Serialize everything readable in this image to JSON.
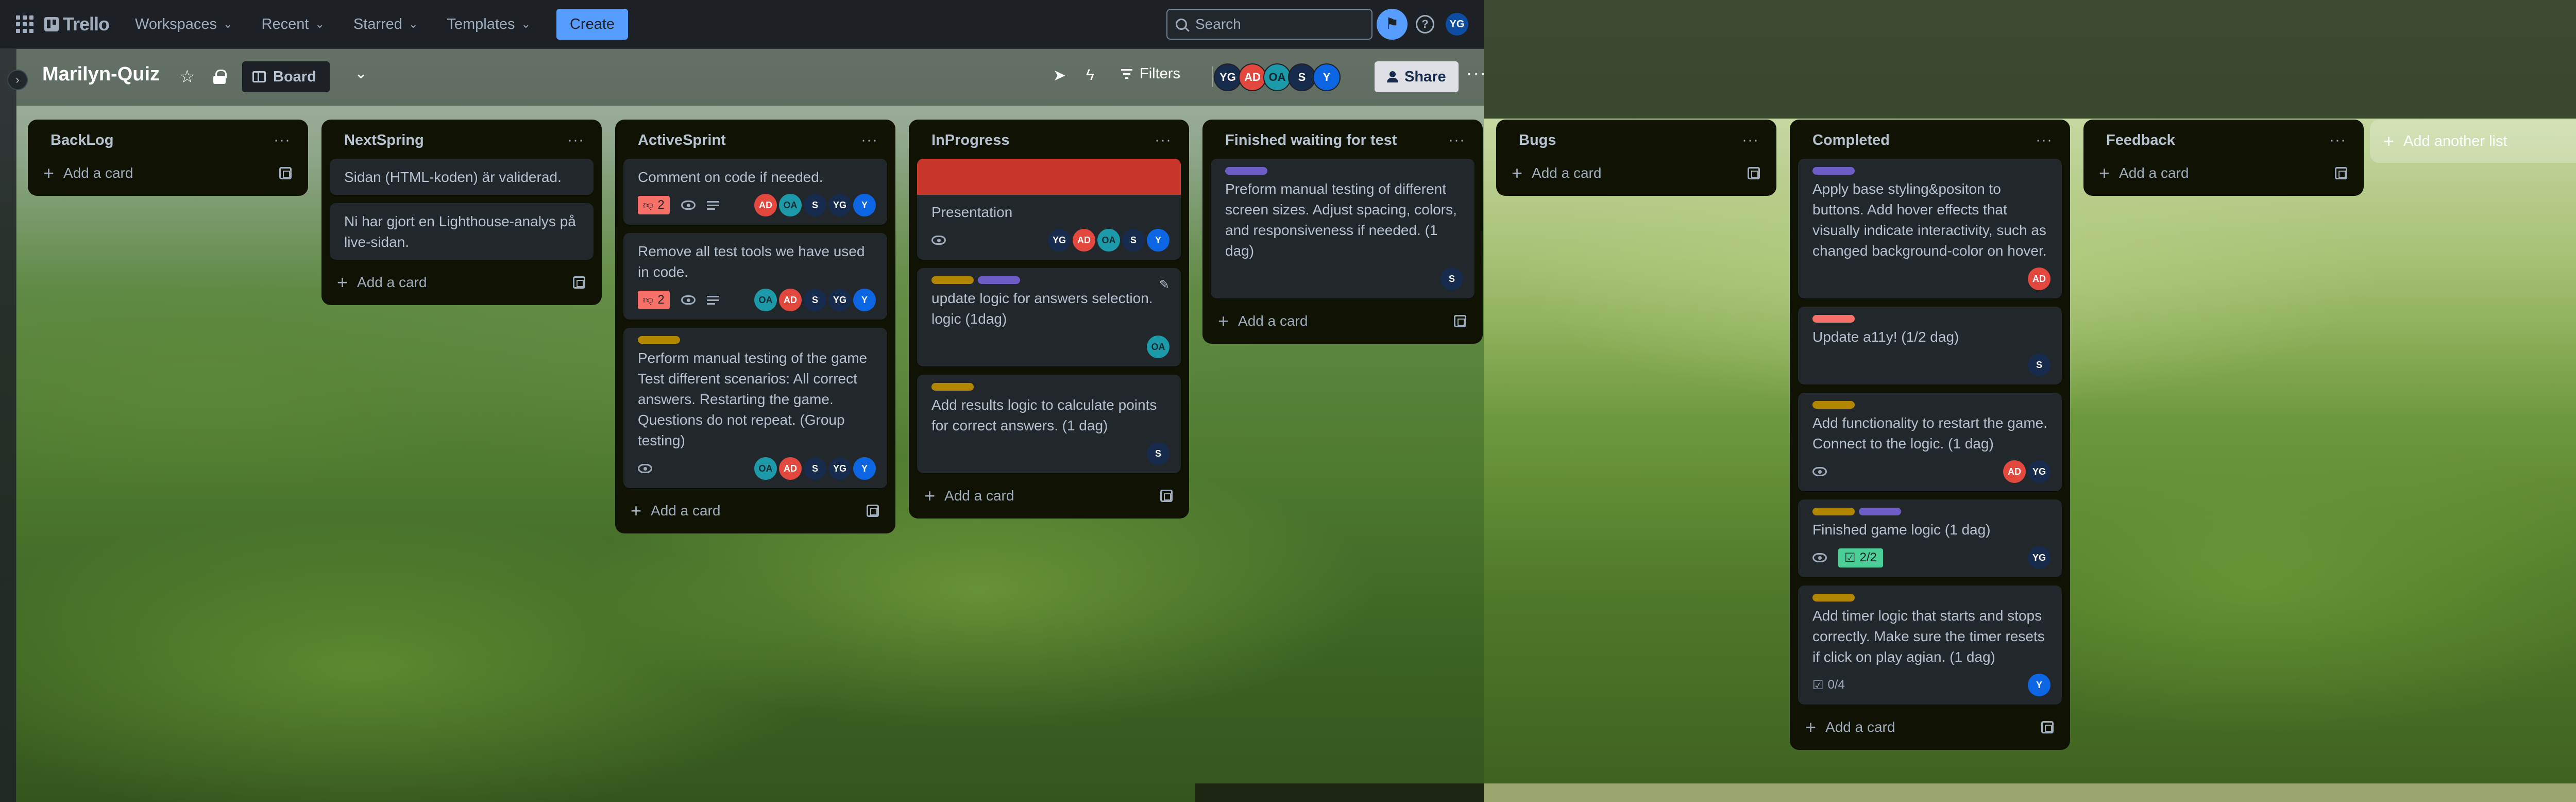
{
  "topbar": {
    "logo": "Trello",
    "menus": [
      "Workspaces",
      "Recent",
      "Starred",
      "Templates"
    ],
    "create_label": "Create",
    "search_placeholder": "Search",
    "avatar": "YG"
  },
  "board": {
    "title": "Marilyn-Quiz",
    "view_label": "Board",
    "filters_label": "Filters",
    "share_label": "Share",
    "members": [
      "YG",
      "AD",
      "OA",
      "S",
      "Y"
    ]
  },
  "add_card_label": "Add a card",
  "add_list_label": "Add another list",
  "lists": [
    {
      "title": "BackLog",
      "cards": []
    },
    {
      "title": "NextSpring",
      "cards": [
        {
          "title": "Sidan (HTML-koden) är validerad."
        },
        {
          "title": "Ni har gjort en Lighthouse-analys på live-sidan."
        }
      ]
    },
    {
      "title": "ActiveSprint",
      "cards": [
        {
          "title": "Comment on code if needed.",
          "votes": "2",
          "members": [
            "AD",
            "OA",
            "S",
            "YG",
            "Y"
          ]
        },
        {
          "title": "Remove all test tools we have used in code.",
          "votes": "2",
          "members": [
            "OA",
            "AD",
            "S",
            "YG",
            "Y"
          ]
        },
        {
          "title": "Perform manual testing of the game Test different scenarios: All correct answers. Restarting the game. Questions do not repeat. (Group testing)",
          "labels": [
            "#b38600"
          ],
          "members": [
            "OA",
            "AD",
            "S",
            "YG",
            "Y"
          ]
        }
      ]
    },
    {
      "title": "InProgress",
      "cards": [
        {
          "title": "Presentation",
          "cover": "#c9372c",
          "members": [
            "YG",
            "AD",
            "OA",
            "S",
            "Y"
          ]
        },
        {
          "title": "update logic for answers selection. logic (1dag)",
          "labels": [
            "#b38600",
            "#6e5dc6"
          ],
          "members": [
            "OA"
          ]
        },
        {
          "title": "Add results logic to calculate points for correct answers. (1 dag)",
          "labels": [
            "#b38600"
          ],
          "members": [
            "S"
          ]
        }
      ]
    },
    {
      "title": "Finished waiting for test",
      "cards": [
        {
          "title": "Preform manual testing of different screen sizes. Adjust spacing, colors, and responsiveness if needed. (1 dag)",
          "labels": [
            "#6e5dc6"
          ],
          "members": [
            "S"
          ]
        }
      ]
    },
    {
      "title": "Bugs",
      "cards": []
    },
    {
      "title": "Completed",
      "cards": [
        {
          "title": "Apply base styling&positon to buttons. Add hover effects that visually indicate interactivity, such as changed background-color on hover.",
          "labels": [
            "#6e5dc6"
          ],
          "members": [
            "AD"
          ]
        },
        {
          "title": "Update a11y! (1/2 dag)",
          "labels": [
            "#f87168"
          ],
          "members": [
            "S"
          ]
        },
        {
          "title": "Add functionality to restart the game. Connect to the logic. (1 dag)",
          "labels": [
            "#b38600"
          ],
          "members": [
            "AD",
            "YG"
          ]
        },
        {
          "title": "Finished game logic (1 dag)",
          "labels": [
            "#b38600",
            "#6e5dc6"
          ],
          "checklist": "2/2",
          "members": [
            "YG"
          ]
        },
        {
          "title": "Add timer logic that starts and stops correctly. Make sure the timer resets if click on play agian. (1 dag)",
          "labels": [
            "#b38600"
          ],
          "checklist": "0/4",
          "members": [
            "Y"
          ]
        }
      ]
    },
    {
      "title": "Feedback",
      "cards": []
    }
  ]
}
